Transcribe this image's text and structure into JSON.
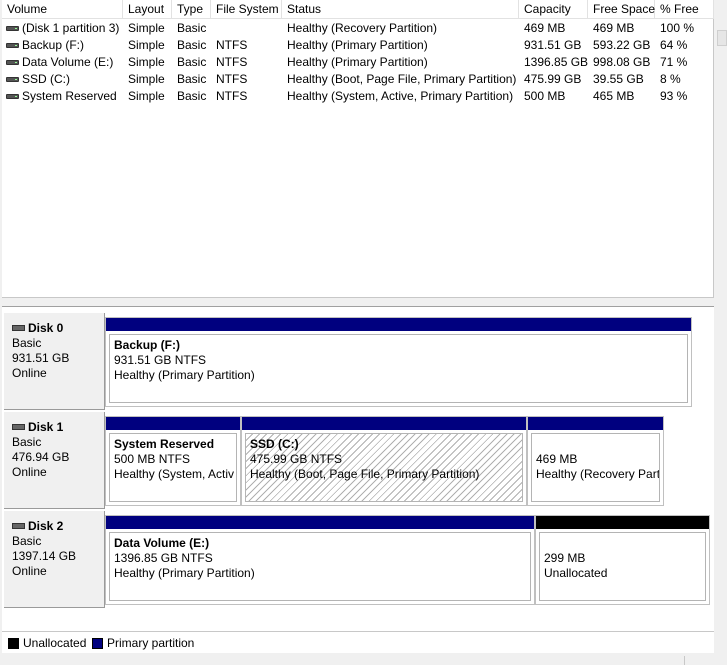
{
  "volumes": {
    "columns": [
      "Volume",
      "Layout",
      "Type",
      "File System",
      "Status",
      "Capacity",
      "Free Space",
      "% Free"
    ],
    "rows": [
      {
        "volume": "(Disk 1 partition 3)",
        "layout": "Simple",
        "type": "Basic",
        "fs": "",
        "status": "Healthy (Recovery Partition)",
        "capacity": "469 MB",
        "free": "469 MB",
        "pct": "100 %"
      },
      {
        "volume": "Backup (F:)",
        "layout": "Simple",
        "type": "Basic",
        "fs": "NTFS",
        "status": "Healthy (Primary Partition)",
        "capacity": "931.51 GB",
        "free": "593.22 GB",
        "pct": "64 %"
      },
      {
        "volume": "Data Volume (E:)",
        "layout": "Simple",
        "type": "Basic",
        "fs": "NTFS",
        "status": "Healthy (Primary Partition)",
        "capacity": "1396.85 GB",
        "free": "998.08 GB",
        "pct": "71 %"
      },
      {
        "volume": "SSD (C:)",
        "layout": "Simple",
        "type": "Basic",
        "fs": "NTFS",
        "status": "Healthy (Boot, Page File, Primary Partition)",
        "capacity": "475.99 GB",
        "free": "39.55 GB",
        "pct": "8 %"
      },
      {
        "volume": "System Reserved",
        "layout": "Simple",
        "type": "Basic",
        "fs": "NTFS",
        "status": "Healthy (System, Active, Primary Partition)",
        "capacity": "500 MB",
        "free": "465 MB",
        "pct": "93 %"
      }
    ]
  },
  "disks": [
    {
      "name": "Disk 0",
      "kind": "Basic",
      "size": "931.51 GB",
      "state": "Online",
      "partitions": [
        {
          "name": "Backup  (F:)",
          "size": "931.51 GB NTFS",
          "status": "Healthy (Primary Partition)",
          "bar": "primary"
        }
      ]
    },
    {
      "name": "Disk 1",
      "kind": "Basic",
      "size": "476.94 GB",
      "state": "Online",
      "partitions": [
        {
          "name": "System Reserved",
          "size": "500 MB NTFS",
          "status": "Healthy (System, Activ",
          "bar": "primary"
        },
        {
          "name": "SSD  (C:)",
          "size": "475.99 GB NTFS",
          "status": "Healthy (Boot, Page File, Primary Partition)",
          "bar": "primary",
          "selected": true
        },
        {
          "name": "",
          "size": "469 MB",
          "status": "Healthy (Recovery Part",
          "bar": "primary"
        }
      ]
    },
    {
      "name": "Disk 2",
      "kind": "Basic",
      "size": "1397.14 GB",
      "state": "Online",
      "partitions": [
        {
          "name": "Data Volume  (E:)",
          "size": "1396.85 GB NTFS",
          "status": "Healthy (Primary Partition)",
          "bar": "primary"
        },
        {
          "name": "",
          "size": "299 MB",
          "status": "Unallocated",
          "bar": "unallocated"
        }
      ]
    }
  ],
  "legend": [
    {
      "label": "Unallocated",
      "color": "#000000"
    },
    {
      "label": "Primary partition",
      "color": "#00007f"
    }
  ]
}
